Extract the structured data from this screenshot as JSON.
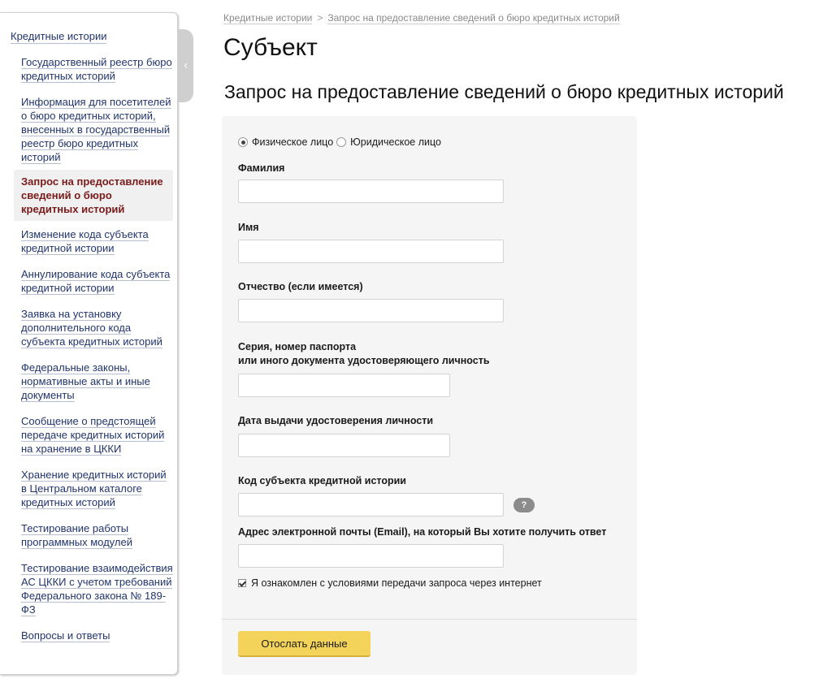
{
  "sidebar": {
    "root_label": "Кредитные истории",
    "items": [
      {
        "label": "Государственный реестр бюро кредитных историй"
      },
      {
        "label": "Информация для посетителей о бюро кредитных историй, внесенных в государственный реестр бюро кредитных историй"
      },
      {
        "label": "Запрос на предоставление сведений о бюро кредитных историй",
        "active": true
      },
      {
        "label": "Изменение кода субъекта кредитной истории"
      },
      {
        "label": "Аннулирование кода субъекта кредитной истории"
      },
      {
        "label": "Заявка на установку дополнительного кода субъекта кредитных историй"
      },
      {
        "label": "Федеральные законы, нормативные акты и иные документы"
      },
      {
        "label": "Сообщение о предстоящей передаче кредитных историй на хранение в ЦККИ"
      },
      {
        "label": "Хранение кредитных историй в Центральном каталоге кредитных историй"
      },
      {
        "label": "Тестирование работы программных модулей"
      },
      {
        "label": "Тестирование взаимодействия АС ЦККИ с учетом требований Федерального закона № 189-ФЗ"
      },
      {
        "label": "Вопросы и ответы"
      }
    ],
    "toggle_icon": "chevron-left-icon"
  },
  "breadcrumb": {
    "items": [
      "Кредитные истории",
      "Запрос на предоставление сведений о бюро кредитных историй"
    ],
    "separator": ">"
  },
  "page": {
    "title": "Субъект",
    "subtitle": "Запрос на предоставление сведений о бюро кредитных историй"
  },
  "form": {
    "person_type": {
      "options": [
        "Физическое лицо",
        "Юридическое лицо"
      ],
      "selected": "Физическое лицо"
    },
    "fields": {
      "surname": {
        "label": "Фамилия",
        "value": ""
      },
      "name": {
        "label": "Имя",
        "value": ""
      },
      "patronymic": {
        "label": "Отчество (если имеется)",
        "value": ""
      },
      "passport_line1": "Серия, номер паспорта",
      "passport_line2": "или иного документа удостоверяющего личность",
      "passport": {
        "value": ""
      },
      "issue_date": {
        "label": "Дата выдачи удостоверения личности",
        "value": ""
      },
      "subject_code": {
        "label": "Код субъекта кредитной истории",
        "value": ""
      },
      "email": {
        "label": "Адрес электронной почты (Email), на который Вы хотите получить ответ",
        "value": ""
      }
    },
    "help_label": "?",
    "agree_label": "Я ознакомлен с условиями передачи запроса через интернет",
    "agree_checked": true,
    "submit_label": "Отослать данные"
  },
  "colors": {
    "link": "#21356e",
    "active_item": "#7a1a1a",
    "button": "#f3d35a",
    "card_bg": "#f5f5f5"
  }
}
